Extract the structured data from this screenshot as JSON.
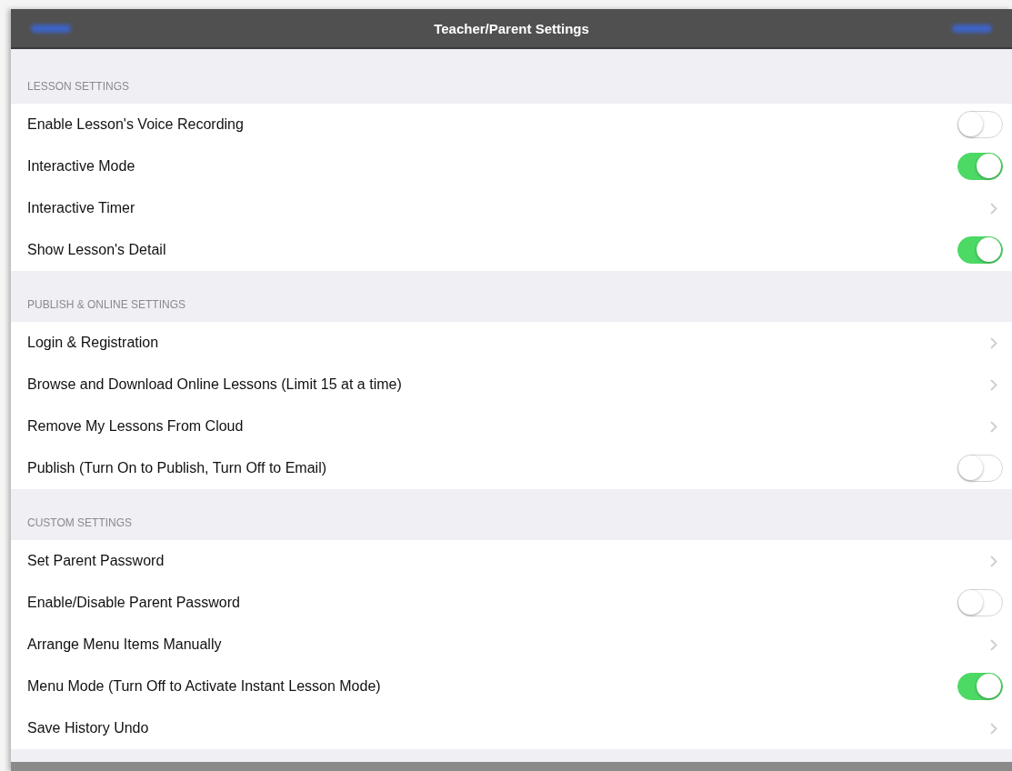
{
  "nav_bar": {
    "title": "Teacher/Parent Settings"
  },
  "sections": [
    {
      "header": "LESSON SETTINGS",
      "rows": [
        {
          "label": "Enable Lesson's Voice Recording",
          "kind": "switch",
          "on": false
        },
        {
          "label": "Interactive Mode",
          "kind": "switch",
          "on": true
        },
        {
          "label": "Interactive Timer",
          "kind": "link"
        },
        {
          "label": "Show Lesson's Detail",
          "kind": "switch",
          "on": true
        }
      ]
    },
    {
      "header": "PUBLISH & ONLINE SETTINGS",
      "rows": [
        {
          "label": "Login & Registration",
          "kind": "link"
        },
        {
          "label": "Browse and Download Online Lessons (Limit 15 at a time)",
          "kind": "link"
        },
        {
          "label": "Remove My Lessons From Cloud",
          "kind": "link"
        },
        {
          "label": "Publish (Turn On to Publish, Turn Off to Email)",
          "kind": "switch",
          "on": false
        }
      ]
    },
    {
      "header": "CUSTOM SETTINGS",
      "rows": [
        {
          "label": "Set Parent Password",
          "kind": "link"
        },
        {
          "label": "Enable/Disable Parent Password",
          "kind": "switch",
          "on": false
        },
        {
          "label": "Arrange Menu Items Manually",
          "kind": "link"
        },
        {
          "label": "Menu Mode (Turn Off to Activate Instant Lesson Mode)",
          "kind": "switch",
          "on": true
        },
        {
          "label": "Save History Undo",
          "kind": "link"
        }
      ]
    }
  ]
}
